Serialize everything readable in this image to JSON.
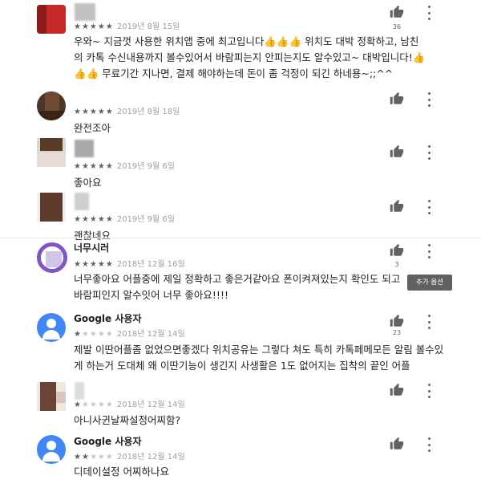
{
  "reviews": [
    {
      "name": "",
      "stars": 5,
      "date": "2019년 8월 15일",
      "body": "우와~ 지금껏 사용한 위치앱 중에 최고입니다👍👍👍 위치도 대박 정확하고, 남친의 카톡 수신내용까지 볼수있어서 바람피는지 안피는지도 알수있고~ 대박입니다!👍👍👍 무료기간 지나면, 결제 해야하는데 돈이 좀 걱정이 되긴 하네용~;;^^",
      "likes": "36"
    },
    {
      "name": "",
      "stars": 5,
      "date": "2019년 8월 18일",
      "body": "완전조아",
      "likes": ""
    },
    {
      "name": "",
      "stars": 5,
      "date": "2019년 9월 6일",
      "body": "좋아요",
      "likes": ""
    },
    {
      "name": "",
      "stars": 5,
      "date": "2019년 9월 6일",
      "body": "괜찮네요",
      "likes": ""
    },
    {
      "name": "너무시러",
      "stars": 5,
      "date": "2018년 12월 16일",
      "body": "너무좋아요 어플중에 제일 정확하고 좋은거같아요 폰이켜져있는지 확인도 되고 바람피인지 알수잇어 너무 좋아요!!!!",
      "likes": "3"
    },
    {
      "name": "Google 사용자",
      "stars": 1,
      "date": "2018년 12월 14일",
      "body": "제발 이딴어플좀 없었으면좋겠다 위치공유는 그렇다 쳐도 특히 카톡페메모든 알림 볼수있게 하는거 도대체 왜 이딴기능이 생긴지 사생활은 1도 없어지는 집착의 끝인 어플",
      "likes": "23"
    },
    {
      "name": "",
      "stars": 1,
      "date": "2018년 12월 14일",
      "body": "아니사귄날짜설정어찌함?",
      "likes": ""
    },
    {
      "name": "Google 사용자",
      "stars": 2,
      "date": "2018년 12월 14일",
      "body": "디데이설정 어찌하나요",
      "likes": ""
    }
  ],
  "tooltip": "추가 옵션",
  "icons": {
    "like": "thumb-up-icon",
    "more": "more-vert-icon",
    "default_avatar": "person-icon"
  },
  "colors": {
    "google_avatar": "#4285f4",
    "star_filled": "#5f6368",
    "star_empty": "#c8c8c8"
  }
}
